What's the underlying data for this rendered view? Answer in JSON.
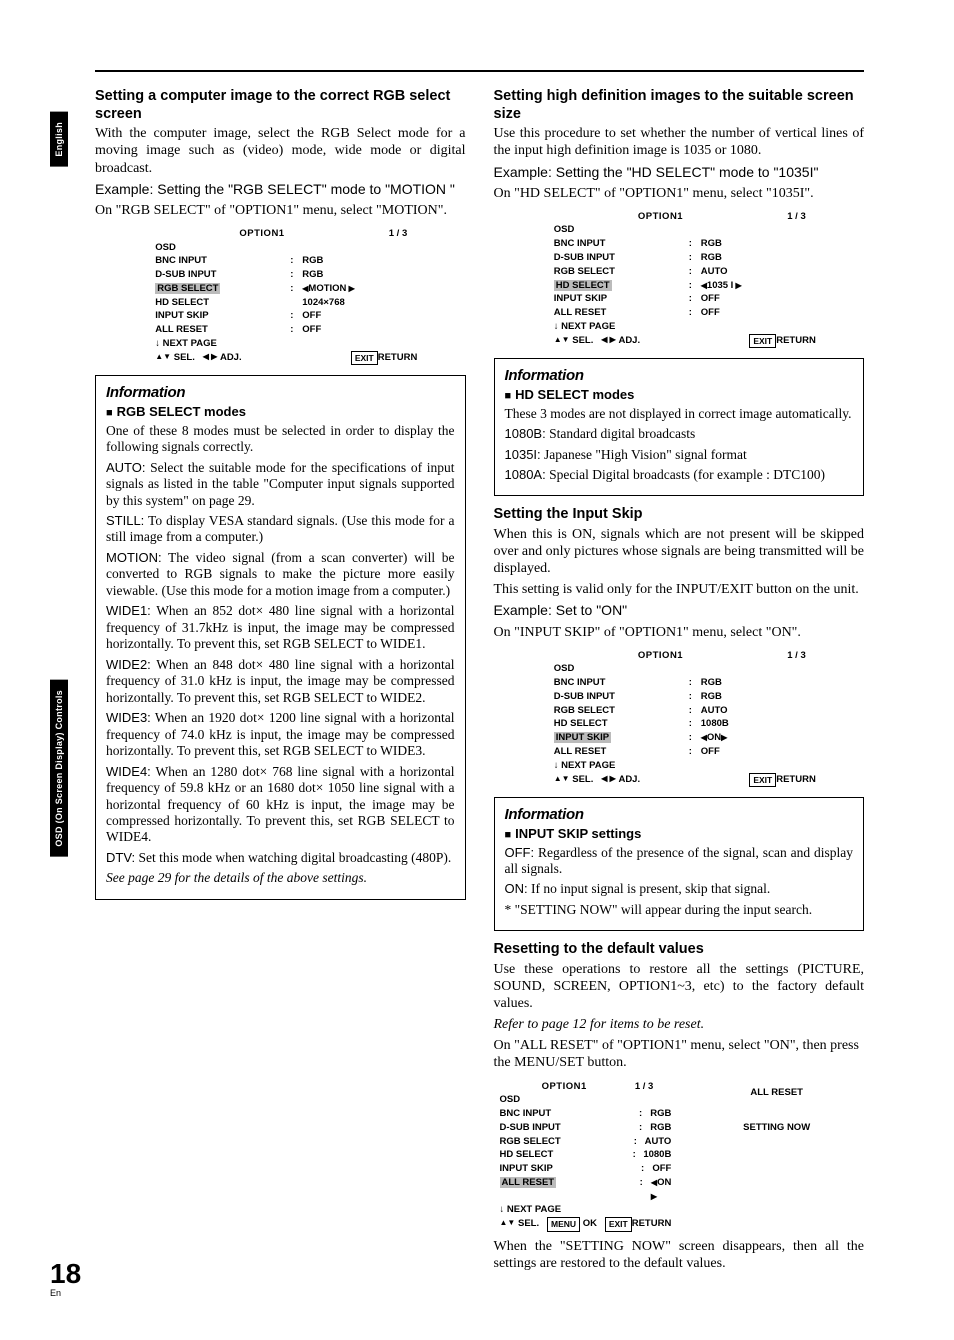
{
  "page_number": "18",
  "page_lang": "En",
  "side_tabs": {
    "english": "English",
    "osd": "OSD (On Screen Display) Controls"
  },
  "left": {
    "h1": "Setting a computer image to the correct RGB select screen",
    "p1": "With the computer image, select the RGB Select mode for a moving image such as (video) mode, wide mode or digital broadcast.",
    "ex1": "Example: Setting the \"RGB SELECT\" mode to \"MOTION \"",
    "p2": "On \"RGB SELECT\" of \"OPTION1\" menu, select \"MOTION\".",
    "info": {
      "title": "Information",
      "sub": "RGB SELECT modes",
      "lead": "One of these 8 modes must be selected in order to display the following signals correctly.",
      "auto_k": "AUTO:",
      "auto": " Select the suitable mode for the specifications of input signals as listed in the table \"Computer input signals supported by this system\" on page 29.",
      "still_k": "STILL:",
      "still": " To display VESA standard signals. (Use this mode for a still image from a computer.)",
      "motion_k": "MOTION:",
      "motion": " The video signal (from a scan converter) will be converted to RGB signals to make the picture more easily viewable. (Use this mode for a motion image from a computer.)",
      "w1_k": "WIDE1:",
      "w1": " When an 852 dot× 480 line signal with a horizontal frequency of 31.7kHz is input, the image may be compressed horizontally. To prevent this, set RGB SELECT to WIDE1.",
      "w2_k": "WIDE2:",
      "w2": " When an 848 dot× 480 line signal with a horizontal frequency of 31.0 kHz is input, the image may be compressed horizontally. To prevent this, set RGB SELECT to WIDE2.",
      "w3_k": "WIDE3:",
      "w3": " When an 1920 dot× 1200 line signal with a horizontal frequency of 74.0 kHz is input, the image may be compressed horizontally. To prevent this, set RGB SELECT to WIDE3.",
      "w4_k": "WIDE4:",
      "w4": " When an 1280 dot× 768 line signal with a horizontal frequency of 59.8 kHz or an 1680 dot× 1050 line signal with a horizontal frequency of 60 kHz is input, the image may be compressed horizontally. To prevent this, set RGB SELECT to WIDE4.",
      "dtv_k": "DTV:",
      "dtv": " Set this mode when watching digital broadcasting (480P).",
      "see": "See page 29 for the details of the above settings."
    }
  },
  "right": {
    "h1": "Setting high definition images to the suitable screen size",
    "p1": "Use this procedure to set whether the number of vertical lines of the input high definition image is 1035 or 1080.",
    "ex1": "Example: Setting the \"HD SELECT\" mode to \"1035I\"",
    "p2": "On \"HD SELECT\" of \"OPTION1\" menu, select \"1035I\".",
    "info1": {
      "title": "Information",
      "sub": "HD SELECT modes",
      "p1": "These 3 modes are not displayed in correct image automatically.",
      "k1": "1080B:",
      "v1": " Standard digital broadcasts",
      "k2": "1035I:",
      "v2": " Japanese \"High Vision\" signal format",
      "k3": "1080A:",
      "v3": " Special Digital broadcasts (for example : DTC100)"
    },
    "h2": "Setting the Input Skip",
    "p3": "When this is ON, signals which are not present will be skipped over and only pictures whose signals are being transmitted will be displayed.",
    "p4": "This setting is valid only for the INPUT/EXIT button on the unit.",
    "ex2": "Example: Set to \"ON\"",
    "p5": "On \"INPUT SKIP\" of \"OPTION1\" menu, select \"ON\".",
    "info2": {
      "title": "Information",
      "sub": "INPUT SKIP settings",
      "off_k": "OFF:",
      "off": " Regardless of the presence of the signal, scan and display all signals.",
      "on_k": "ON:",
      "on": " If no input signal is present, skip that signal.",
      "note": "*  \"SETTING NOW\" will appear during the input search."
    },
    "h3": "Resetting to the default values",
    "p6": "Use these operations to restore all the settings (PICTURE, SOUND, SCREEN, OPTION1~3, etc) to the factory default values.",
    "p7": "Refer to page 12 for items to be reset.",
    "p8": "On \"ALL RESET\" of \"OPTION1\" menu, select \"ON\", then press the MENU/SET button.",
    "panel2": {
      "t": "ALL RESET",
      "b": "SETTING NOW"
    },
    "p9": "When the \"SETTING NOW\" screen disappears, then all the settings are restored to the default values."
  },
  "menus": {
    "common": {
      "title": "OPTION1",
      "page": "1 / 3",
      "osd": "OSD",
      "bnc": "BNC INPUT",
      "dsub": "D-SUB INPUT",
      "rgbsel": "RGB SELECT",
      "hdsel": "HD SELECT",
      "inskip": "INPUT SKIP",
      "allreset": "ALL RESET",
      "next": "↓  NEXT PAGE",
      "sel": "SEL.",
      "adj": "ADJ.",
      "ok": "OK",
      "exit": "EXIT",
      "menu": "MENU",
      "return": "RETURN",
      "rgb": "RGB",
      "auto": "AUTO",
      "off": "OFF",
      "b1080": "1080B",
      "on": "ON",
      "i1035": "1035 I",
      "motion": "MOTION",
      "res": "1024×768"
    }
  }
}
